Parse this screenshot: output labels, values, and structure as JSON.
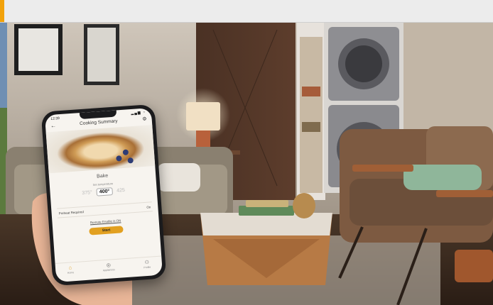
{
  "phone": {
    "status_time": "12:39",
    "status_right": "▂▄▆ ◔",
    "header_title": "Cooking Summary",
    "mode": "Bake",
    "temp_caption": "Set temperature",
    "temps": [
      "375°",
      "400°",
      "425"
    ],
    "selected_temp_index": 1,
    "preheat_label": "Preheat Required",
    "preheat_value": "On",
    "remote_enable_link": "Remote Enable is ON",
    "start_button": "Start",
    "nav_items": [
      "Home",
      "Appliances",
      "Profile"
    ]
  },
  "colors": {
    "accent": "#e2a020",
    "topbar": "#ececec",
    "topbar_accent": "#f2a20a"
  },
  "icons": [
    "back-arrow-icon",
    "settings-icon",
    "home-icon",
    "appliances-icon",
    "profile-icon"
  ]
}
